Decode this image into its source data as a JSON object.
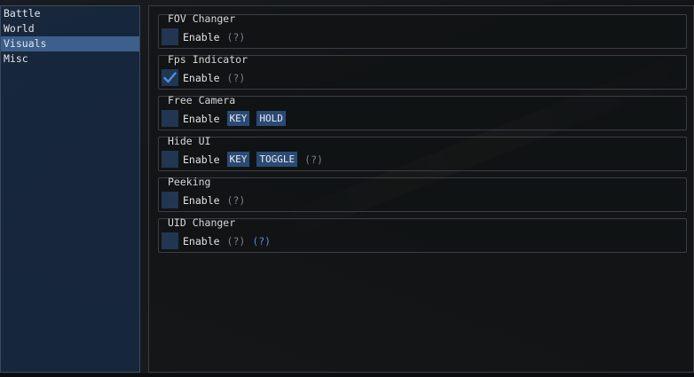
{
  "sidebar": {
    "items": [
      {
        "label": "Battle",
        "active": false
      },
      {
        "label": "World",
        "active": false
      },
      {
        "label": "Visuals",
        "active": true
      },
      {
        "label": "Misc",
        "active": false
      }
    ]
  },
  "groups": [
    {
      "title": "FOV Changer",
      "checked": false,
      "enable_label": "Enable",
      "help": "(?)"
    },
    {
      "title": "Fps Indicator",
      "checked": true,
      "enable_label": "Enable",
      "help": "(?)"
    },
    {
      "title": "Free Camera",
      "checked": false,
      "enable_label": "Enable",
      "key_label": "KEY",
      "mode_label": "HOLD"
    },
    {
      "title": "Hide UI",
      "checked": false,
      "enable_label": "Enable",
      "key_label": "KEY",
      "mode_label": "TOGGLE",
      "help": "(?)"
    },
    {
      "title": "Peeking",
      "checked": false,
      "enable_label": "Enable",
      "help": "(?)"
    },
    {
      "title": "UID Changer",
      "checked": false,
      "enable_label": "Enable",
      "help": "(?)",
      "help2": "(?)"
    }
  ],
  "colors": {
    "accent": "#3c5f8c",
    "checkbox": "#223652",
    "checkmark": "#4a90e0",
    "key_button": "#2a4a74",
    "help_link": "#5a8ad8"
  },
  "icons": {
    "checkmark": "check-icon"
  }
}
